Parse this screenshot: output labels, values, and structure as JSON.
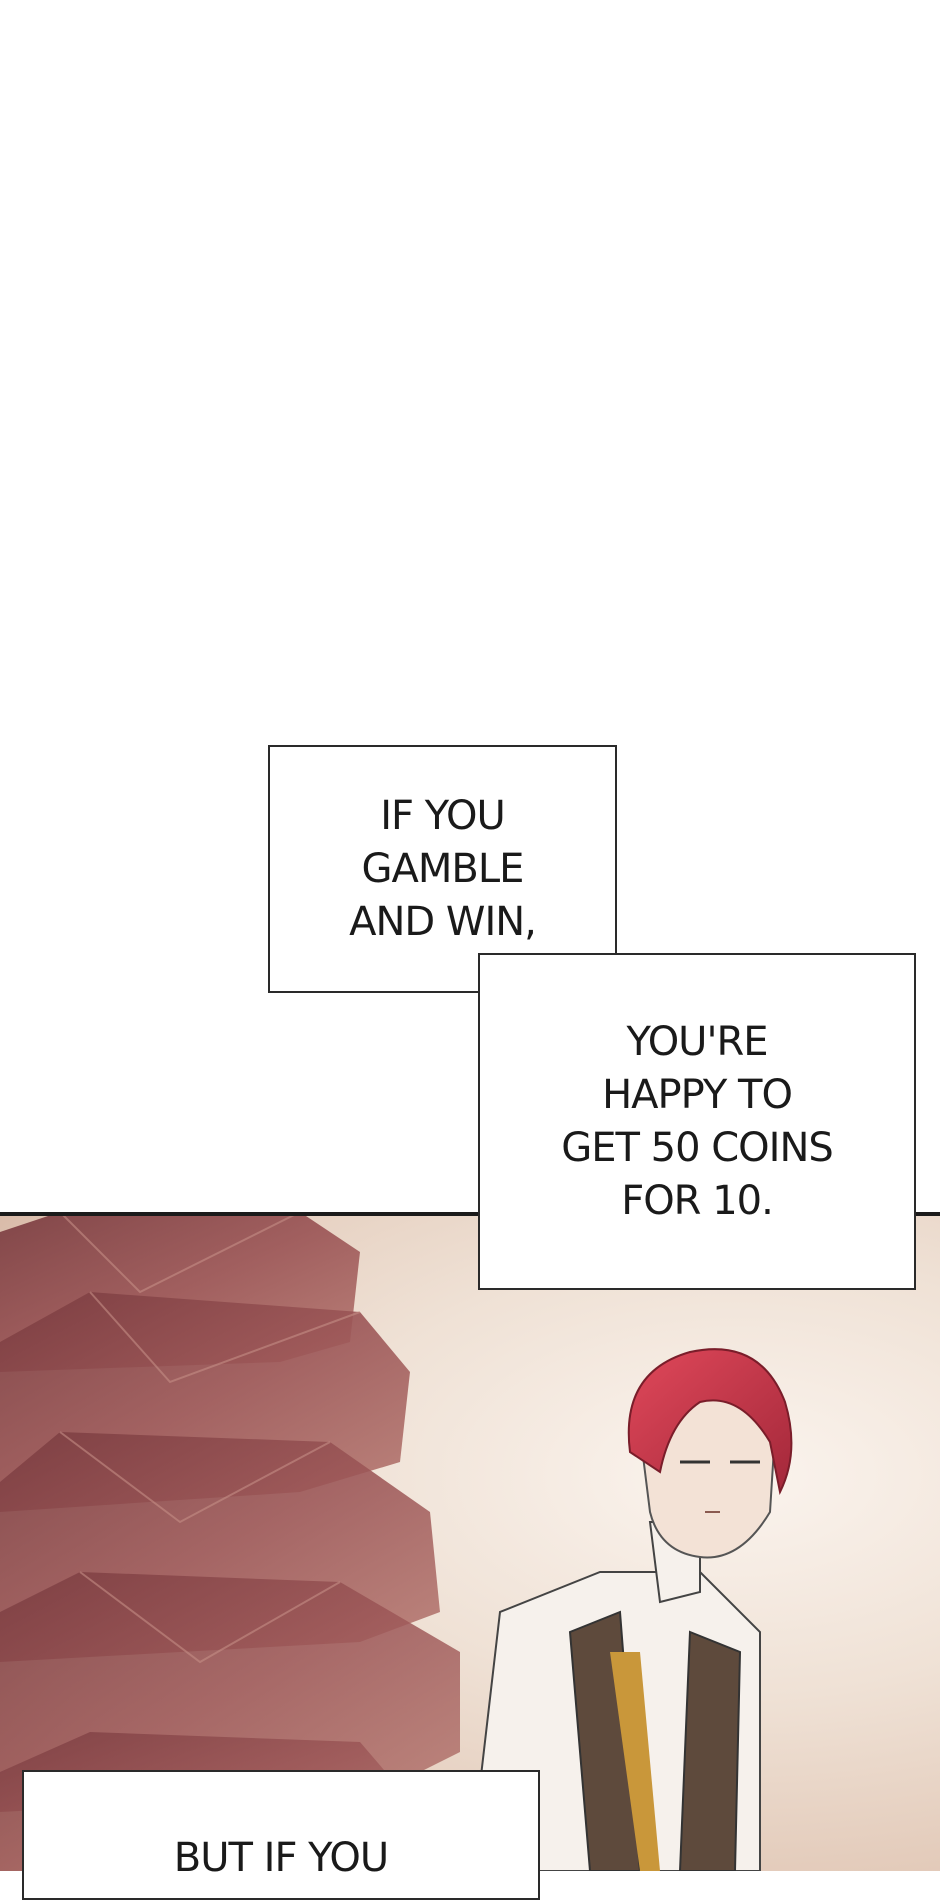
{
  "captions": {
    "first": "IF YOU\nGAMBLE\nAND WIN,",
    "second": "YOU'RE\nHAPPY TO\nGET 50 COINS\nFOR 10.",
    "third": "BUT IF YOU"
  },
  "colors": {
    "background": "#ffffff",
    "panel_border": "#1b1b1b",
    "gem": "#8e4a4d",
    "hair": "#c8364a",
    "vest": "#5e4a3c",
    "trim": "#c9973a"
  },
  "icons": [
    "ruby-gem-illustration",
    "red-haired-character-illustration"
  ]
}
